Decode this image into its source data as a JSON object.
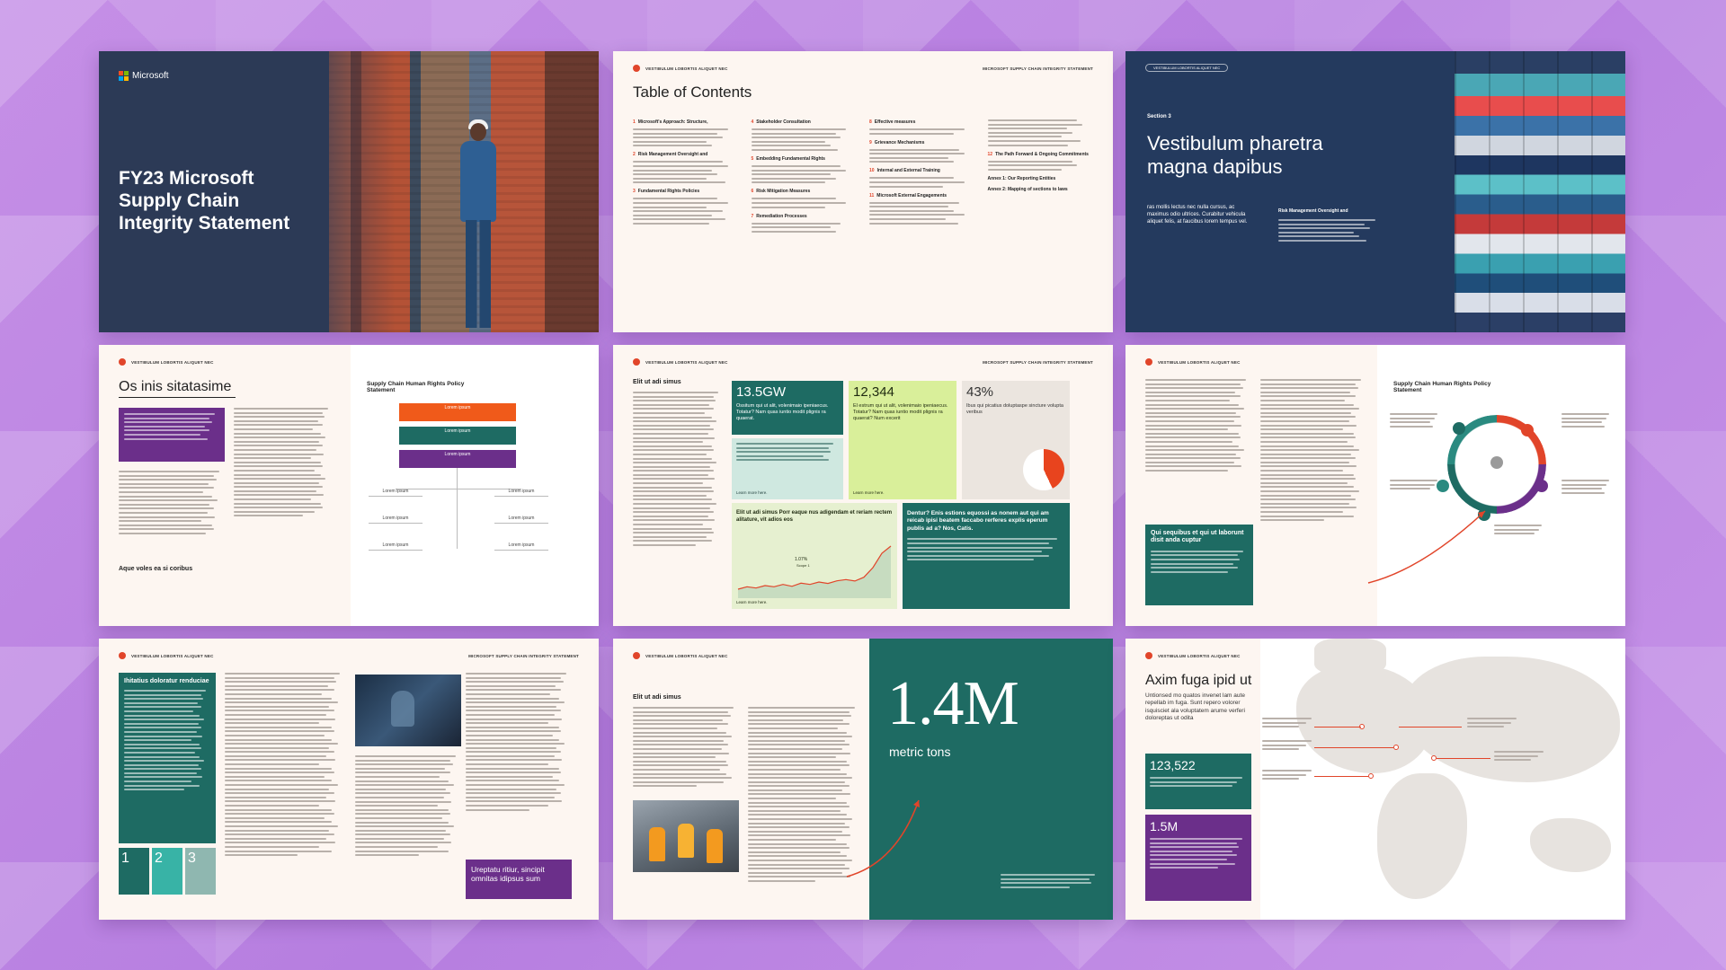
{
  "cover": {
    "brand": "Microsoft",
    "title": "FY23 Microsoft Supply Chain Integrity Statement"
  },
  "header": {
    "left": "VESTIBULUM LOBORTIS ALIQUET NEC",
    "right": "MICROSOFT SUPPLY CHAIN INTEGRITY STATEMENT"
  },
  "toc": {
    "title": "Table of Contents",
    "sections": [
      {
        "n": "1",
        "label": "Microsoft's Approach: Structure,"
      },
      {
        "n": "2",
        "label": "Risk Management Oversight and"
      },
      {
        "n": "3",
        "label": "Fundamental Rights Policies"
      },
      {
        "n": "4",
        "label": "Stakeholder Consultation"
      },
      {
        "n": "5",
        "label": "Embedding Fundamental Rights"
      },
      {
        "n": "6",
        "label": "Risk Mitigation Measures"
      },
      {
        "n": "7",
        "label": "Remediation Processes"
      },
      {
        "n": "8",
        "label": "Effective measures"
      },
      {
        "n": "9",
        "label": "Grievance Mechanisms"
      },
      {
        "n": "10",
        "label": "Internal and External Training"
      },
      {
        "n": "11",
        "label": "Microsoft External Engagements"
      },
      {
        "n": "12",
        "label": "The Path Forward & Ongoing Commitments"
      },
      {
        "n": "",
        "label": "Annex 1: Our Reporting Entities"
      },
      {
        "n": "",
        "label": "Annex 2: Mapping of sections to laws"
      }
    ]
  },
  "section3": {
    "pill": "VESTIBULUM LOBORTIS ALIQUET NEC",
    "label": "Section 3",
    "title": "Vestibulum pharetra magna dapibus",
    "para": "ras mollis lectus nec nulla cursus, ac maximus odio ultrices. Curabitur vehicula aliquet felis, at faucibus lorem tempus vel.",
    "side_heading": "Risk Management Oversight and"
  },
  "page4": {
    "title": "Os inis sitatasime",
    "subhead": "Aque voles ea si coribus",
    "side_title": "Supply Chain Human Rights Policy Statement",
    "box_label": "Lorem ipsum"
  },
  "page5": {
    "heading": "Elit ut adi simus",
    "stats": [
      {
        "num": "13.5GW",
        "text": "Ossitum qui ut alit, volenimaio ipeniaecus. Totatur? Nam quas iuntio modit plignis ra quaerat."
      },
      {
        "num": "12,344",
        "text": "El estrum qui ut alit, volenimaio ipeniaecus. Totatur? Nam quas iuntio modit plignis ra quaerat? Num excerit"
      },
      {
        "num": "43%",
        "text": "Ibus qui picatius doluptaspe sincture volupta veribus"
      }
    ],
    "learn_more": "Learn more here.",
    "chart_title": "Elit ut adi simus Porr eaque nus adigendam et reriam rectem alitature, vit adios eos",
    "chart_label": "1.07%",
    "chart_sublabel": "Scope 1",
    "teal_heading": "Dentur? Enis estions equossi as nonem aut qui am reicab ipisi beatem faccabo rerferes explis eperum publis ad a? Nos, Catis."
  },
  "page6": {
    "side_title": "Supply Chain Human Rights Policy Statement",
    "box_heading": "Qui sequibus et qui ut laborunt disit anda cuptur"
  },
  "page7": {
    "heading": "Ihitatius doloratur renduciae",
    "numbers": [
      "1",
      "2",
      "3"
    ],
    "pullquote": "Ureptatu ritiur, sincipit omnitas idipsus sum"
  },
  "page8": {
    "heading": "Elit ut adi simus",
    "big_number": "1.4M",
    "unit": "metric tons"
  },
  "page9": {
    "title": "Axim fuga ipid ut",
    "intro": "Untionsed mo quatos invenet lam aute repellab im fuga. Sunt repero volorer isquisciet ala voluptatem arume verferi doloreptas ut odita",
    "stat1": "123,522",
    "stat2": "1.5M"
  },
  "colors": {
    "accent": "#e1452a",
    "teal": "#1e6b63",
    "purple": "#6b2f8a",
    "navy": "#243a5e"
  },
  "chart_data": {
    "type": "line",
    "x": [
      1,
      2,
      3,
      4,
      5,
      6,
      7,
      8,
      9,
      10,
      11,
      12,
      13,
      14,
      15,
      16,
      17,
      18
    ],
    "values": [
      3,
      4,
      3.5,
      4.5,
      4,
      5,
      4.2,
      5.5,
      5,
      6,
      5.4,
      6.5,
      7,
      6.4,
      8,
      12,
      18,
      21
    ],
    "ylim": [
      0,
      24
    ]
  }
}
